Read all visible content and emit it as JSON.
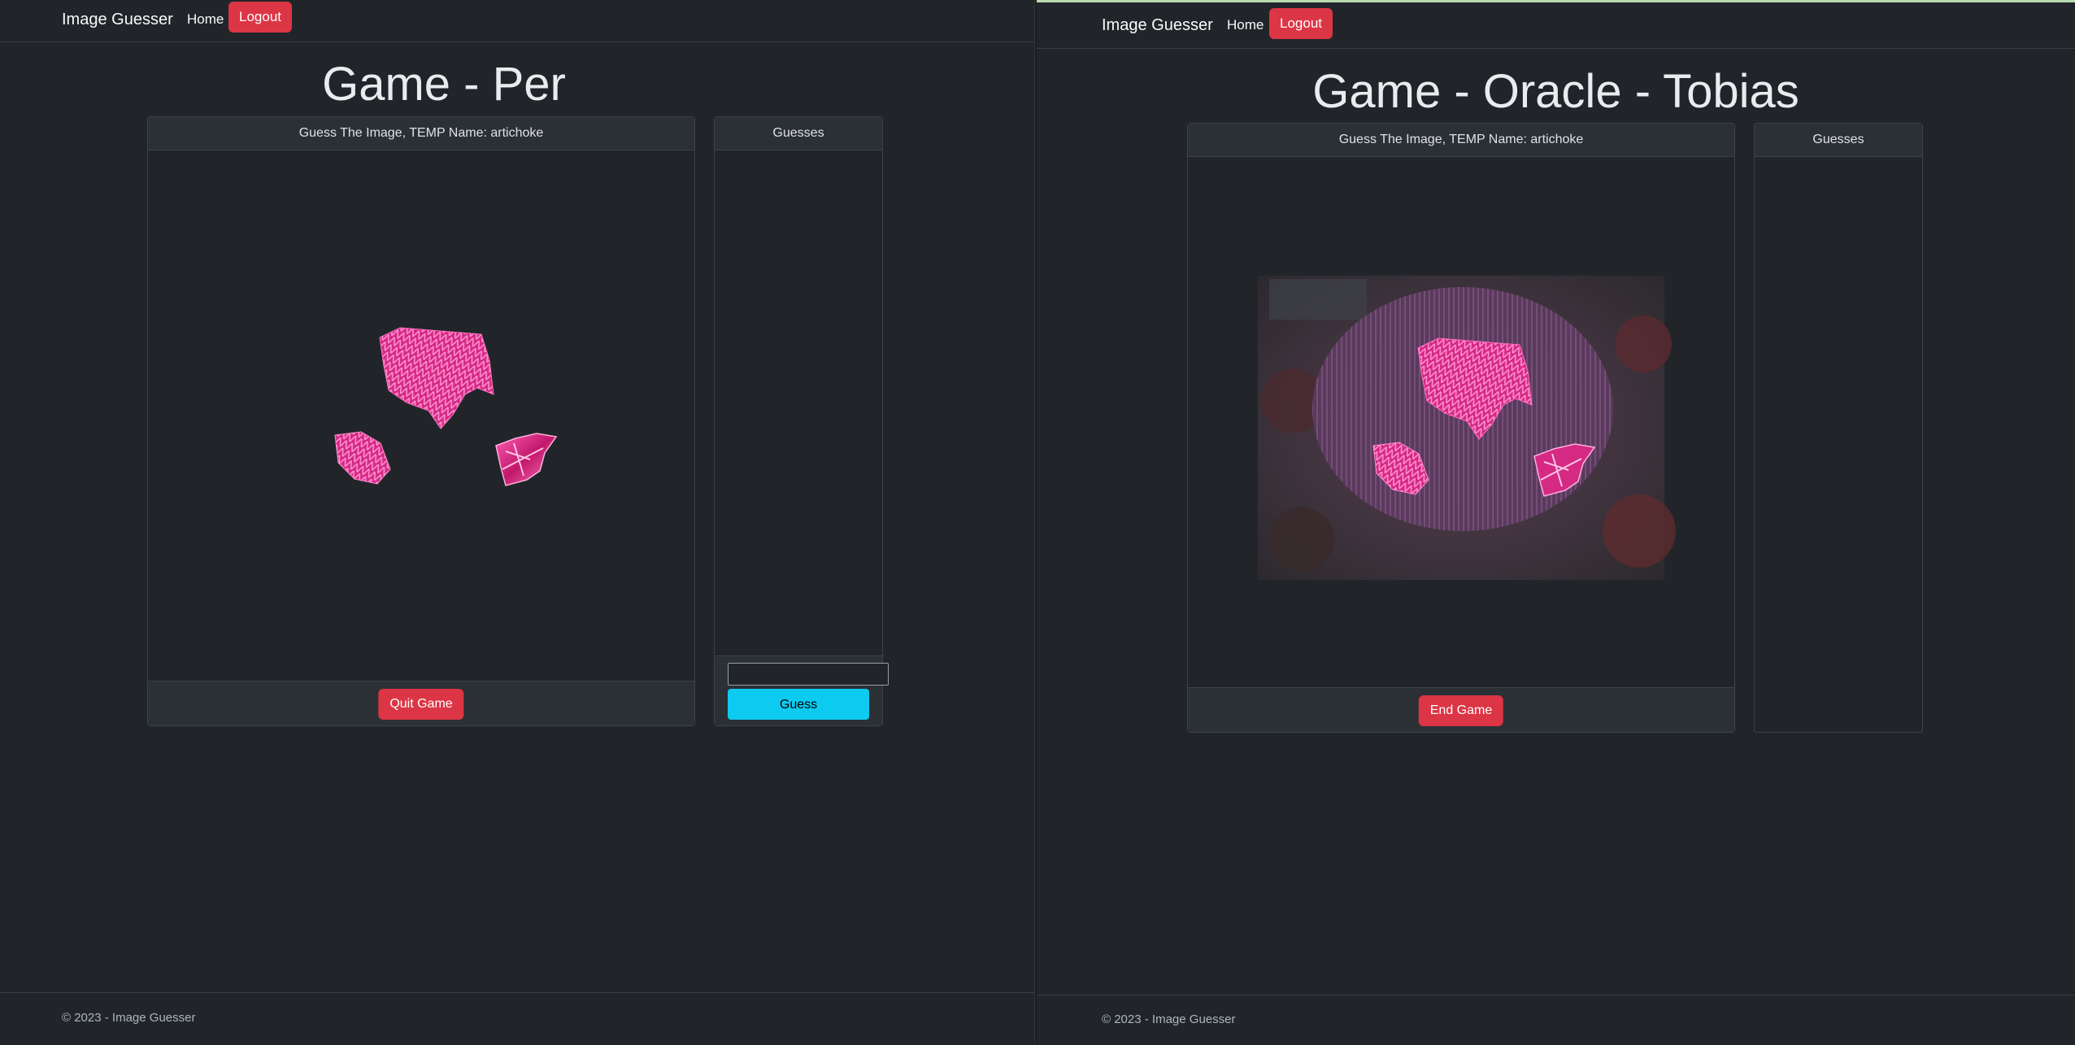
{
  "left": {
    "brand": "Image Guesser",
    "nav_home": "Home",
    "logout": "Logout",
    "title": "Game - Per",
    "image_card_header": "Guess The Image, TEMP Name: artichoke",
    "quit_button": "Quit Game",
    "guesses_header": "Guesses",
    "guess_input_value": "",
    "guess_button": "Guess",
    "footer": "© 2023 - Image Guesser"
  },
  "right": {
    "brand": "Image Guesser",
    "nav_home": "Home",
    "logout": "Logout",
    "title": "Game - Oracle - Tobias",
    "image_card_header": "Guess The Image, TEMP Name: artichoke",
    "end_button": "End Game",
    "guesses_header": "Guesses",
    "footer": "© 2023 - Image Guesser"
  },
  "colors": {
    "background": "#212529",
    "danger": "#dc3545",
    "info": "#0dcaf0",
    "artichoke_pink": "#d63384"
  }
}
